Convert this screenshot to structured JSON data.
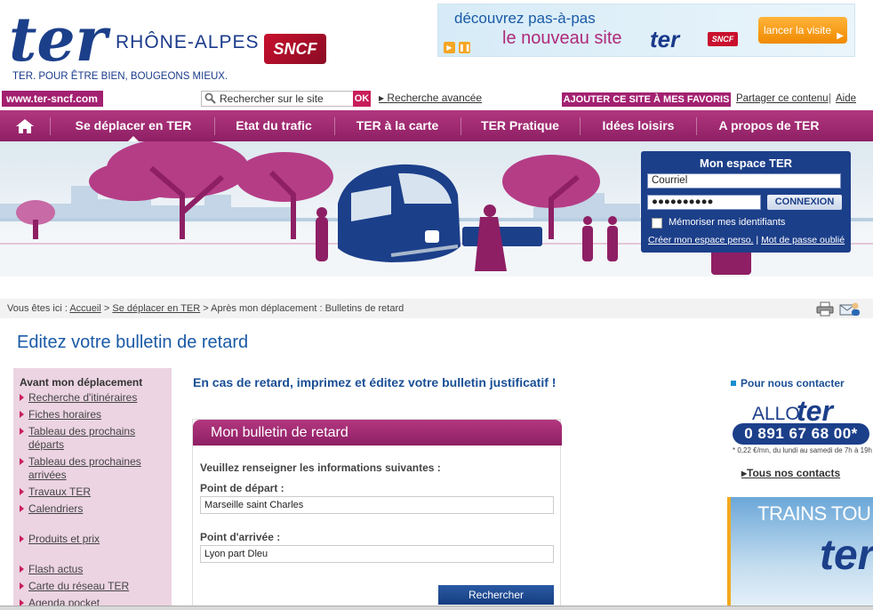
{
  "header": {
    "logo_text": "ter",
    "region": "RHÔNE-ALPES",
    "tagline": "TER. POUR ÊTRE BIEN, BOUGEONS MIEUX.",
    "sncf_logo": "SNCF",
    "promo": {
      "line1": "découvrez pas-à-pas",
      "line2": "le nouveau site",
      "logo_ter": "ter",
      "logo_sncf": "SNCF",
      "button_label": "lancer la visite"
    }
  },
  "toolbar": {
    "site_url": "www.ter-sncf.com",
    "search_placeholder": "Rechercher sur le site",
    "ok_label": "OK",
    "advanced_search": "Recherche avancée",
    "favorites": "AJOUTER CE SITE À MES FAVORIS",
    "share": "Partager ce contenu",
    "separator": "|",
    "help": "Aide"
  },
  "nav": {
    "items": [
      "Se déplacer en TER",
      "Etat du trafic",
      "TER à la carte",
      "TER Pratique",
      "Idées loisirs",
      "A propos de TER"
    ]
  },
  "login": {
    "title": "Mon espace TER",
    "email_value": "Courriel",
    "password_value": "●●●●●●●●●●",
    "connect_label": "CONNEXION",
    "remember_label": "Mémoriser mes identifiants",
    "create_link": "Créer mon espace perso.",
    "link_separator": "|",
    "forgot_link": "Mot de passe oublié"
  },
  "breadcrumb": {
    "prefix": "Vous êtes ici :",
    "home": "Accueil",
    "sep": ">",
    "section": "Se déplacer en TER",
    "current": "Après mon déplacement : Bulletins de retard"
  },
  "page_title": "Editez votre bulletin de retard",
  "sidebar": {
    "heading": "Avant mon déplacement",
    "items": [
      "Recherche d'itinéraires",
      "Fiches horaires",
      "Tableau des prochains départs",
      "Tableau des prochaines arrivées",
      "Travaux TER",
      "Calendriers",
      "Produits et prix",
      "Flash actus",
      "Carte du réseau TER",
      "Agenda pocket"
    ]
  },
  "main": {
    "intro": "En cas de retard, imprimez et éditez votre bulletin justificatif !",
    "form_title": "Mon bulletin de retard",
    "form_instruction": "Veuillez renseigner les informations suivantes :",
    "departure_label": "Point de départ :",
    "departure_value": "Marseille saint Charles",
    "arrival_label": "Point d'arrivée :",
    "arrival_value": "Lyon part Dleu",
    "search_button": "Rechercher"
  },
  "contact": {
    "heading": "Pour nous contacter",
    "allo": "ALLO",
    "allo_ter": "ter",
    "phone": "0 891 67 68 00*",
    "note": "* 0,22 €/mn, du lundi au samedi de 7h à 19h",
    "all_contacts": "Tous nos contacts"
  },
  "ad": {
    "text": "TRAINS TOU",
    "logo": "ter"
  },
  "colors": {
    "magenta": "#a32070",
    "navy": "#1c3f8a",
    "link_blue": "#1a5aa6"
  }
}
